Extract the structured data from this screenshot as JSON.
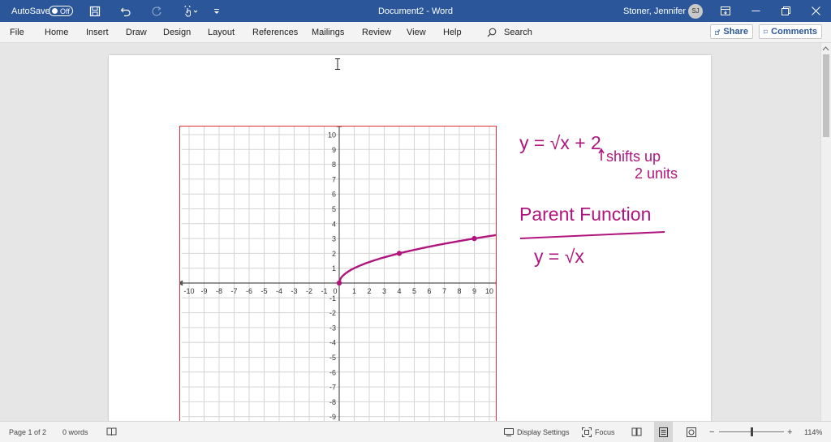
{
  "titlebar": {
    "autosave_label": "AutoSave",
    "autosave_state": "Off",
    "document_title": "Document2 - Word",
    "user_name": "Stoner, Jennifer L",
    "user_initials": "SJ"
  },
  "menu": {
    "items": [
      "File",
      "Home",
      "Insert",
      "Draw",
      "Design",
      "Layout",
      "References",
      "Mailings",
      "Review",
      "View",
      "Help"
    ],
    "search_label": "Search",
    "share_label": "Share",
    "comments_label": "Comments"
  },
  "graph": {
    "x_ticks": [
      "-10",
      "-9",
      "-8",
      "-7",
      "-6",
      "-5",
      "-4",
      "-3",
      "-2",
      "-1",
      "0",
      "1",
      "2",
      "3",
      "4",
      "5",
      "6",
      "7",
      "8",
      "9",
      "10"
    ],
    "y_ticks": [
      "10",
      "9",
      "8",
      "7",
      "6",
      "5",
      "4",
      "3",
      "2",
      "1",
      "-1",
      "-2",
      "-3",
      "-4",
      "-5",
      "-6",
      "-7",
      "-8",
      "-9"
    ],
    "curve_points": [
      [
        0,
        0
      ],
      [
        4,
        2
      ],
      [
        9,
        3
      ]
    ]
  },
  "handwriting": {
    "equation_transformed": "y = √x + 2",
    "note_line1": "shifts up",
    "note_line2": "2 units",
    "heading": "Parent Function",
    "equation_parent": "y = √x"
  },
  "status": {
    "page": "Page 1 of 2",
    "words": "0 words",
    "display_settings": "Display Settings",
    "focus": "Focus",
    "zoom": "114%"
  },
  "colors": {
    "accent": "#2b579a",
    "ink": "#b0157e",
    "graph_frame": "#e03030"
  }
}
